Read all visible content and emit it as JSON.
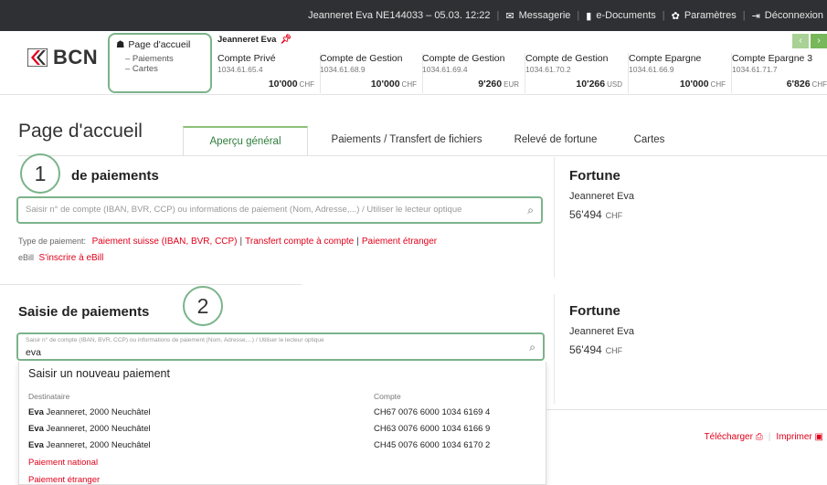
{
  "topbar": {
    "user_info": "Jeanneret Eva   NE144033 – 05.03. 12:22",
    "messagerie": "Messagerie",
    "edocuments": "e-Documents",
    "parametres": "Paramètres",
    "deconnexion": "Déconnexion"
  },
  "logo": {
    "text": "BCN",
    "brand_color": "#e2001a"
  },
  "nav": {
    "home": "Page d'accueil",
    "items": [
      "– Paiements",
      "– Cartes"
    ]
  },
  "accounts": {
    "owner": "Jeanneret Eva",
    "list": [
      {
        "name": "Compte Privé",
        "number": "1034.61.65.4",
        "balance": "10'000",
        "currency": "CHF"
      },
      {
        "name": "Compte de Gestion",
        "number": "1034.61.68.9",
        "balance": "10'000",
        "currency": "CHF"
      },
      {
        "name": "Compte de Gestion",
        "number": "1034.61.69.4",
        "balance": "9'260",
        "currency": "EUR"
      },
      {
        "name": "Compte de Gestion",
        "number": "1034.61.70.2",
        "balance": "10'266",
        "currency": "USD"
      },
      {
        "name": "Compte Epargne",
        "number": "1034.61.66.9",
        "balance": "10'000",
        "currency": "CHF"
      },
      {
        "name": "Compte Epargne 3",
        "number": "1034.61.71.7",
        "balance": "6'826",
        "currency": "CHF"
      }
    ]
  },
  "page": {
    "title": "Page d'accueil",
    "tabs": [
      "Aperçu général",
      "Paiements / Transfert de fichiers",
      "Relevé de fortune",
      "Cartes"
    ]
  },
  "panel1": {
    "step": "1",
    "title": "Saisie de paiements",
    "title_visible": "de paiements",
    "search_placeholder": "Saisir n° de compte (IBAN, BVR, CCP) ou informations de paiement (Nom, Adresse,...) / Utiliser le lecteur optique",
    "type_label": "Type de paiement:",
    "type_links": [
      "Paiement suisse (IBAN, BVR, CCP)",
      "Transfert compte à compte",
      "Paiement étranger"
    ],
    "ebill_label": "eBill",
    "ebill_link": "S'inscrire à eBill"
  },
  "fortune1": {
    "title": "Fortune",
    "owner": "Jeanneret Eva",
    "value": "56'494",
    "currency": "CHF"
  },
  "panel2": {
    "step": "2",
    "title": "Saisie de paiements",
    "search_label": "Saisir n° de compte (IBAN, BVR, CCP) ou informations de paiement (Nom, Adresse,...) / Utiliser le lecteur optique",
    "search_value": "eva"
  },
  "fortune2": {
    "title": "Fortune",
    "owner": "Jeanneret Eva",
    "value": "56'494",
    "currency": "CHF"
  },
  "dropdown": {
    "title": "Saisir un nouveau paiement",
    "col_dest": "Destinataire",
    "col_account": "Compte",
    "rows": [
      {
        "bold": "Eva",
        "rest": " Jeanneret, 2000 Neuchâtel",
        "account": "CH67 0076 6000 1034 6169 4"
      },
      {
        "bold": "Eva",
        "rest": " Jeanneret, 2000 Neuchâtel",
        "account": "CH63 0076 6000 1034 6166 9"
      },
      {
        "bold": "Eva",
        "rest": " Jeanneret, 2000 Neuchâtel",
        "account": "CH45 0076 6000 1034 6170 2"
      }
    ],
    "links": [
      "Paiement national",
      "Paiement étranger"
    ]
  },
  "actions": {
    "download": "Télécharger",
    "print": "Imprimer"
  }
}
